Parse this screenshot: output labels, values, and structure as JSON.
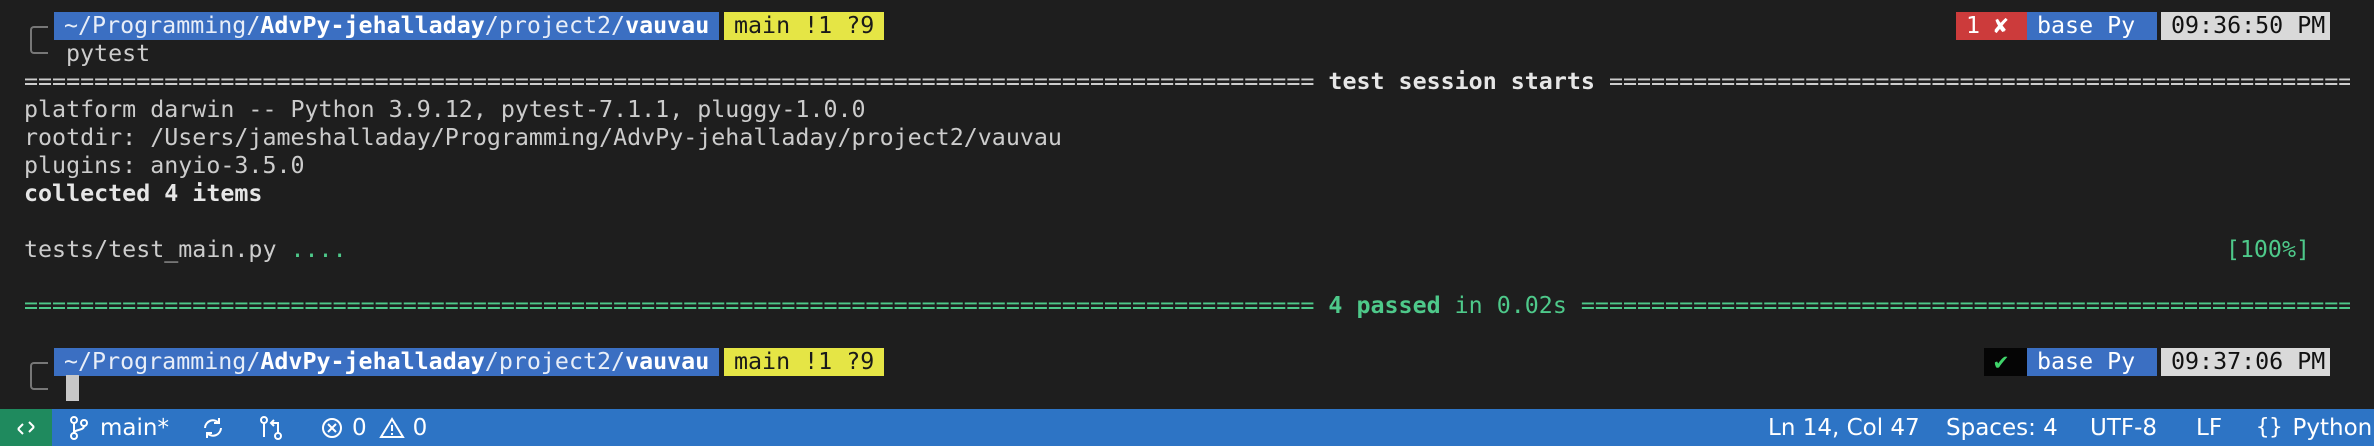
{
  "terminal": {
    "prompt1": {
      "dir_prefix": "~/Programming/",
      "dir_bold1": "AdvPy-jehalladay",
      "dir_mid": "/project2/",
      "dir_bold2": "vauvau",
      "git": "main !1 ?9",
      "status": "1 ✘",
      "env": "base Py",
      "time": "09:36:50 PM"
    },
    "command": "pytest",
    "session_header": {
      "sep_left": "============================================================================================",
      "label": " test session starts ",
      "sep_right": "======================================================================================================="
    },
    "platform_line": "platform darwin -- Python 3.9.12, pytest-7.1.1, pluggy-1.0.0",
    "rootdir_line": "rootdir: /Users/jameshalladay/Programming/AdvPy-jehalladay/project2/vauvau",
    "plugins_line": "plugins: anyio-3.5.0",
    "collected_line": "collected 4 items",
    "test_file": "tests/test_main.py ",
    "test_dots": "....",
    "test_percent": "[100%]",
    "summary": {
      "sep_left": "============================================================================================",
      "passed": " 4 passed",
      "in_time": " in 0.02s ",
      "sep_right": "======================================================================================================="
    },
    "prompt2": {
      "dir_prefix": "~/Programming/",
      "dir_bold1": "AdvPy-jehalladay",
      "dir_mid": "/project2/",
      "dir_bold2": "vauvau",
      "git": "main !1 ?9",
      "status": "✔",
      "env": "base Py",
      "time": "09:37:06 PM"
    }
  },
  "statusbar": {
    "branch": "main*",
    "errors": "0",
    "warnings": "0",
    "position": "Ln 14, Col 47",
    "spaces": "Spaces: 4",
    "encoding": "UTF-8",
    "eol": "LF",
    "language": "Python",
    "colors": {
      "background": "#2d74c5",
      "remote": "#1f8a5e"
    }
  }
}
